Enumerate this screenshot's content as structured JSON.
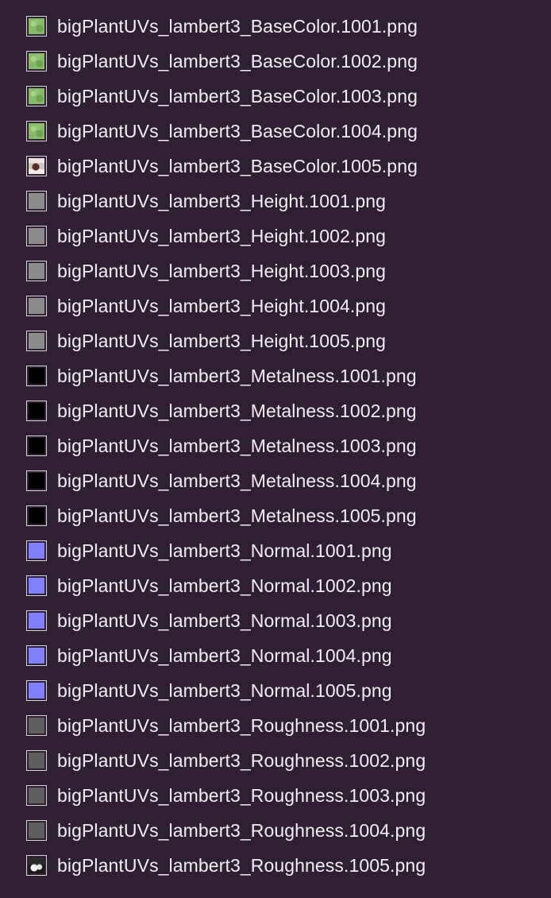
{
  "files": [
    {
      "name": "bigPlantUVs_lambert3_BaseColor.1001.png",
      "thumb_kind": "basecolor",
      "thumb_color": "#87ba66"
    },
    {
      "name": "bigPlantUVs_lambert3_BaseColor.1002.png",
      "thumb_kind": "basecolor",
      "thumb_color": "#87ba66"
    },
    {
      "name": "bigPlantUVs_lambert3_BaseColor.1003.png",
      "thumb_kind": "basecolor",
      "thumb_color": "#87ba66"
    },
    {
      "name": "bigPlantUVs_lambert3_BaseColor.1004.png",
      "thumb_kind": "basecolor",
      "thumb_color": "#87ba66"
    },
    {
      "name": "bigPlantUVs_lambert3_BaseColor.1005.png",
      "thumb_kind": "basecolor-alt",
      "thumb_color": "#e9e4e0"
    },
    {
      "name": "bigPlantUVs_lambert3_Height.1001.png",
      "thumb_kind": "height",
      "thumb_color": "#8b8b8b"
    },
    {
      "name": "bigPlantUVs_lambert3_Height.1002.png",
      "thumb_kind": "height",
      "thumb_color": "#8b8b8b"
    },
    {
      "name": "bigPlantUVs_lambert3_Height.1003.png",
      "thumb_kind": "height",
      "thumb_color": "#8b8b8b"
    },
    {
      "name": "bigPlantUVs_lambert3_Height.1004.png",
      "thumb_kind": "height",
      "thumb_color": "#8b8b8b"
    },
    {
      "name": "bigPlantUVs_lambert3_Height.1005.png",
      "thumb_kind": "height",
      "thumb_color": "#8b8b8b"
    },
    {
      "name": "bigPlantUVs_lambert3_Metalness.1001.png",
      "thumb_kind": "metalness",
      "thumb_color": "#000000"
    },
    {
      "name": "bigPlantUVs_lambert3_Metalness.1002.png",
      "thumb_kind": "metalness",
      "thumb_color": "#000000"
    },
    {
      "name": "bigPlantUVs_lambert3_Metalness.1003.png",
      "thumb_kind": "metalness",
      "thumb_color": "#000000"
    },
    {
      "name": "bigPlantUVs_lambert3_Metalness.1004.png",
      "thumb_kind": "metalness",
      "thumb_color": "#000000"
    },
    {
      "name": "bigPlantUVs_lambert3_Metalness.1005.png",
      "thumb_kind": "metalness",
      "thumb_color": "#000000"
    },
    {
      "name": "bigPlantUVs_lambert3_Normal.1001.png",
      "thumb_kind": "normal",
      "thumb_color": "#8080ff"
    },
    {
      "name": "bigPlantUVs_lambert3_Normal.1002.png",
      "thumb_kind": "normal",
      "thumb_color": "#8080ff"
    },
    {
      "name": "bigPlantUVs_lambert3_Normal.1003.png",
      "thumb_kind": "normal",
      "thumb_color": "#8080ff"
    },
    {
      "name": "bigPlantUVs_lambert3_Normal.1004.png",
      "thumb_kind": "normal",
      "thumb_color": "#8080ff"
    },
    {
      "name": "bigPlantUVs_lambert3_Normal.1005.png",
      "thumb_kind": "normal",
      "thumb_color": "#8080ff"
    },
    {
      "name": "bigPlantUVs_lambert3_Roughness.1001.png",
      "thumb_kind": "roughness",
      "thumb_color": "#5e5e5e"
    },
    {
      "name": "bigPlantUVs_lambert3_Roughness.1002.png",
      "thumb_kind": "roughness",
      "thumb_color": "#5e5e5e"
    },
    {
      "name": "bigPlantUVs_lambert3_Roughness.1003.png",
      "thumb_kind": "roughness",
      "thumb_color": "#5e5e5e"
    },
    {
      "name": "bigPlantUVs_lambert3_Roughness.1004.png",
      "thumb_kind": "roughness",
      "thumb_color": "#5e5e5e"
    },
    {
      "name": "bigPlantUVs_lambert3_Roughness.1005.png",
      "thumb_kind": "roughness-alt",
      "thumb_color": "#1a1a1a"
    }
  ],
  "colors": {
    "background": "#2f1f33",
    "text": "#f2eef4",
    "thumb_border": "#d8d2db"
  }
}
